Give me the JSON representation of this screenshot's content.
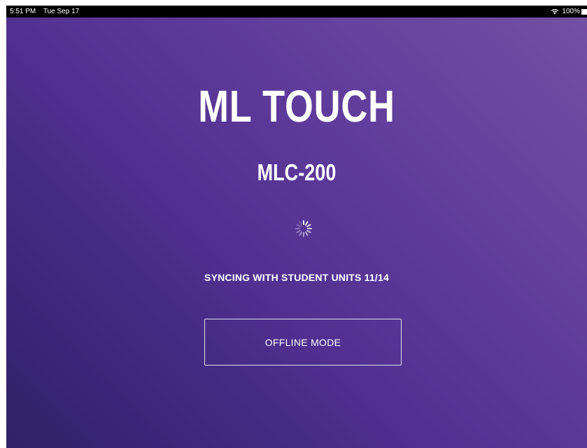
{
  "status_bar": {
    "time": "5:51 PM",
    "date": "Tue Sep 17",
    "battery": "100%",
    "wifi_icon": "wifi-icon",
    "battery_icon": "battery-icon"
  },
  "app": {
    "title": "ML TOUCH",
    "model": "MLC-200",
    "spinner_icon": "loading-spinner-icon",
    "sync_status": "SYNCING WITH STUDENT UNITS 11/14",
    "offline_button_label": "OFFLINE MODE"
  },
  "colors": {
    "background_start": "#7350a2",
    "background_end": "#2f2368",
    "text": "#ffffff"
  }
}
